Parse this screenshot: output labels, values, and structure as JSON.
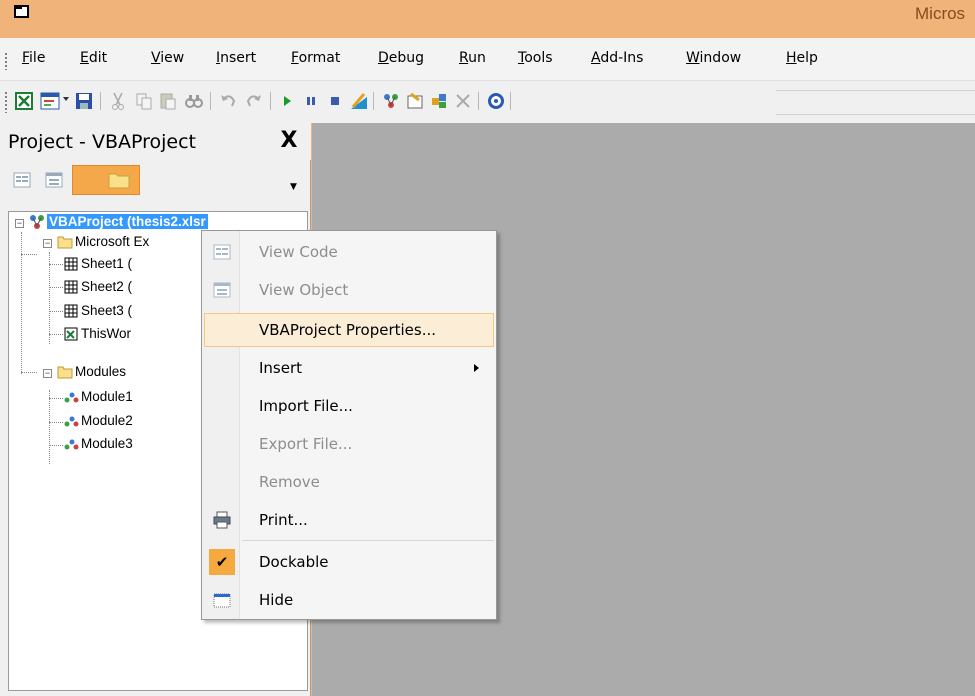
{
  "window": {
    "title_visible": "Micros"
  },
  "menubar": {
    "items": [
      "File",
      "Edit",
      "View",
      "Insert",
      "Format",
      "Debug",
      "Run",
      "Tools",
      "Add-Ins",
      "Window",
      "Help"
    ]
  },
  "project_panel": {
    "title": "Project - VBAProject",
    "close_label": "X"
  },
  "tree": {
    "root": "VBAProject (thesis2.xlsr",
    "folder_excel": "Microsoft Ex",
    "sheet1": "Sheet1 (",
    "sheet2": "Sheet2 (",
    "sheet3": "Sheet3 (",
    "thisworkbook": "ThisWor",
    "folder_modules": "Modules",
    "module1": "Module1",
    "module2": "Module2",
    "module3": "Module3"
  },
  "context_menu": {
    "view_code": "View Code",
    "view_object": "View Object",
    "properties": "VBAProject Properties...",
    "insert": "Insert",
    "import_file": "Import File...",
    "export_file": "Export File...",
    "remove": "Remove",
    "print": "Print...",
    "dockable": "Dockable",
    "hide": "Hide"
  },
  "colors": {
    "title_bar": "#f0b37a",
    "selection": "#3399ff",
    "menu_hover": "#fcedd7",
    "check_accent": "#f6a93e",
    "code_area": "#ababab"
  }
}
